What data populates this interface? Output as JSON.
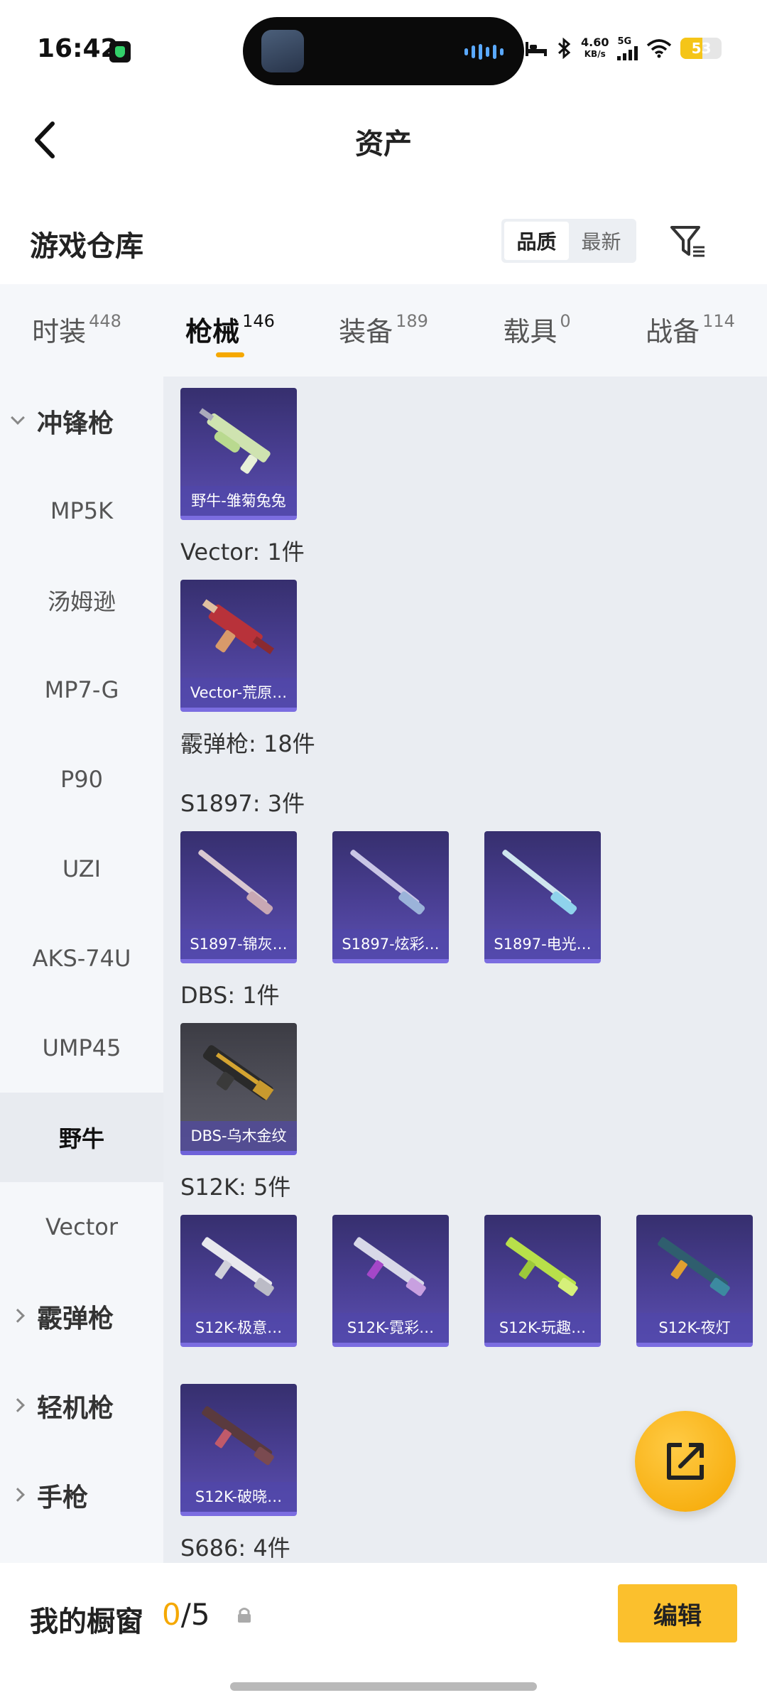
{
  "status_bar": {
    "time": "16:42",
    "net_speed_value": "4.60",
    "net_speed_unit": "KB/s",
    "network_type": "5G",
    "battery": "53",
    "battery_level": 0.53
  },
  "header": {
    "title": "资产"
  },
  "section": {
    "title": "游戏仓库",
    "sort_options": [
      "品质",
      "最新"
    ]
  },
  "tabs": [
    {
      "label": "时装",
      "count": "448"
    },
    {
      "label": "枪械",
      "count": "146"
    },
    {
      "label": "装备",
      "count": "189"
    },
    {
      "label": "载具",
      "count": "0"
    },
    {
      "label": "战备",
      "count": "114"
    }
  ],
  "sidebar": {
    "group_open": "冲锋枪",
    "items": [
      "MP5K",
      "汤姆逊",
      "MP7-G",
      "P90",
      "UZI",
      "AKS-74U",
      "UMP45",
      "野牛",
      "Vector"
    ],
    "groups_closed": [
      "霰弹枪",
      "轻机枪",
      "手枪"
    ]
  },
  "content": {
    "groups": [
      {
        "header": "Vector: 1件"
      },
      {
        "header": "霰弹枪: 18件"
      },
      {
        "header": "S1897: 3件"
      },
      {
        "header": "DBS: 1件"
      },
      {
        "header": "S12K: 5件"
      },
      {
        "header": "S686: 4件"
      }
    ],
    "cards": [
      {
        "label": "野牛-雏菊兔兔",
        "icon": "bizon-gun-icon"
      },
      {
        "label": "Vector-荒原…",
        "icon": "vector-gun-icon"
      },
      {
        "label": "S1897-锦灰…",
        "icon": "shotgun-icon"
      },
      {
        "label": "S1897-炫彩…",
        "icon": "shotgun-icon"
      },
      {
        "label": "S1897-电光…",
        "icon": "shotgun-icon"
      },
      {
        "label": "DBS-乌木金纹",
        "icon": "dbs-gun-icon"
      },
      {
        "label": "S12K-极意…",
        "icon": "rifle-gun-icon"
      },
      {
        "label": "S12K-霓彩…",
        "icon": "rifle-gun-icon"
      },
      {
        "label": "S12K-玩趣…",
        "icon": "rifle-gun-icon"
      },
      {
        "label": "S12K-夜灯",
        "icon": "rifle-gun-icon"
      },
      {
        "label": "S12K-破晓…",
        "icon": "rifle-gun-icon"
      }
    ]
  },
  "bottom": {
    "showcase_label": "我的橱窗",
    "showcase_current": "0",
    "showcase_total": "/5",
    "edit_label": "编辑"
  },
  "colors": {
    "accent": "#f5a800",
    "card_purple": "#4a3f94"
  }
}
